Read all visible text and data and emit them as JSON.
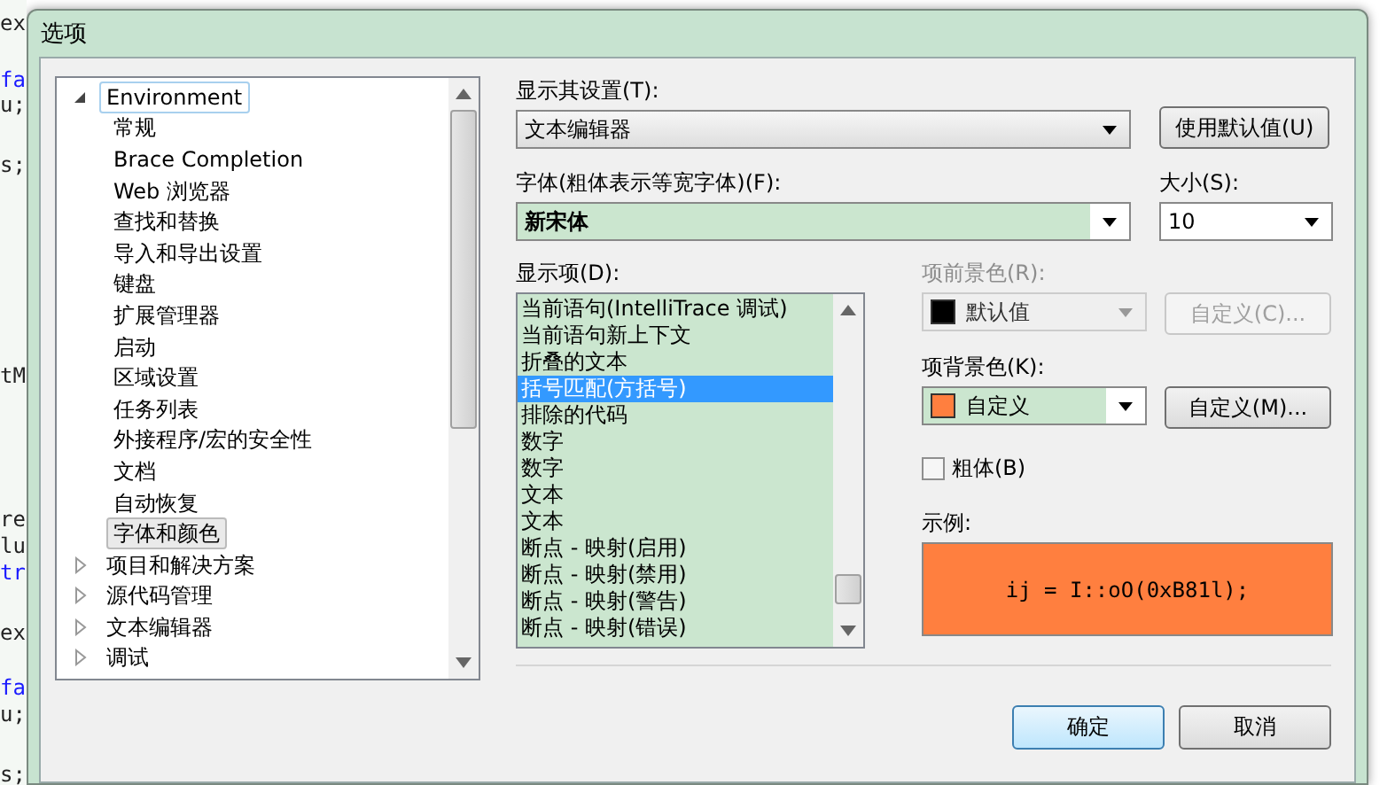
{
  "background_code": [
    {
      "text": "ex",
      "kind": "plain"
    },
    {
      "text": "fa",
      "kind": "keyword"
    },
    {
      "text": "u;",
      "kind": "plain"
    },
    {
      "text": "s;",
      "kind": "plain"
    },
    {
      "text": "tM",
      "kind": "plain"
    },
    {
      "text": "re",
      "kind": "plain"
    },
    {
      "text": "lu",
      "kind": "plain"
    },
    {
      "text": "tr",
      "kind": "keyword"
    },
    {
      "text": "ex",
      "kind": "plain"
    },
    {
      "text": "fa",
      "kind": "keyword"
    },
    {
      "text": "u;",
      "kind": "plain"
    },
    {
      "text": "s;",
      "kind": "plain"
    }
  ],
  "window": {
    "title": "选项"
  },
  "tree": [
    {
      "label": "Environment",
      "expanded": true,
      "focused": true,
      "selected": false,
      "children": [
        {
          "label": "常规",
          "selected": false
        },
        {
          "label": "Brace Completion",
          "selected": false
        },
        {
          "label": "Web 浏览器",
          "selected": false
        },
        {
          "label": "查找和替换",
          "selected": false
        },
        {
          "label": "导入和导出设置",
          "selected": false
        },
        {
          "label": "键盘",
          "selected": false
        },
        {
          "label": "扩展管理器",
          "selected": false
        },
        {
          "label": "启动",
          "selected": false
        },
        {
          "label": "区域设置",
          "selected": false
        },
        {
          "label": "任务列表",
          "selected": false
        },
        {
          "label": "外接程序/宏的安全性",
          "selected": false
        },
        {
          "label": "文档",
          "selected": false
        },
        {
          "label": "自动恢复",
          "selected": false
        },
        {
          "label": "字体和颜色",
          "selected": true
        }
      ]
    },
    {
      "label": "项目和解决方案",
      "expanded": false,
      "focused": false,
      "selected": false
    },
    {
      "label": "源代码管理",
      "expanded": false,
      "focused": false,
      "selected": false
    },
    {
      "label": "文本编辑器",
      "expanded": false,
      "focused": false,
      "selected": false
    },
    {
      "label": "调试",
      "expanded": false,
      "focused": false,
      "selected": false
    }
  ],
  "show_settings_for": {
    "label": "显示其设置(T):",
    "value": "文本编辑器",
    "button": "使用默认值(U)"
  },
  "font": {
    "label": "字体(粗体表示等宽字体)(F):",
    "value": "新宋体"
  },
  "size": {
    "label": "大小(S):",
    "value": "10"
  },
  "display_items": {
    "label": "显示项(D):",
    "items": [
      {
        "label": "当前语句(IntelliTrace 调试)",
        "selected": false
      },
      {
        "label": "当前语句新上下文",
        "selected": false
      },
      {
        "label": "折叠的文本",
        "selected": false
      },
      {
        "label": "括号匹配(方括号)",
        "selected": true
      },
      {
        "label": "排除的代码",
        "selected": false
      },
      {
        "label": "数字",
        "selected": false
      },
      {
        "label": "数字",
        "selected": false
      },
      {
        "label": "文本",
        "selected": false
      },
      {
        "label": "文本",
        "selected": false
      },
      {
        "label": "断点 - 映射(启用)",
        "selected": false
      },
      {
        "label": "断点 - 映射(禁用)",
        "selected": false
      },
      {
        "label": "断点 - 映射(警告)",
        "selected": false
      },
      {
        "label": "断点 - 映射(错误)",
        "selected": false
      }
    ]
  },
  "foreground": {
    "label": "项前景色(R):",
    "value": "默认值",
    "color": "#000000",
    "disabled": true,
    "button": "自定义(C)..."
  },
  "background": {
    "label": "项背景色(K):",
    "value": "自定义",
    "color": "#ff7f3f",
    "disabled": false,
    "button": "自定义(M)..."
  },
  "bold": {
    "label": "粗体(B)",
    "checked": false
  },
  "sample": {
    "label": "示例:",
    "text": "ij = I::oO(0xB81l);"
  },
  "buttons": [
    {
      "label": "确定",
      "default": true
    },
    {
      "label": "取消",
      "default": false
    }
  ]
}
